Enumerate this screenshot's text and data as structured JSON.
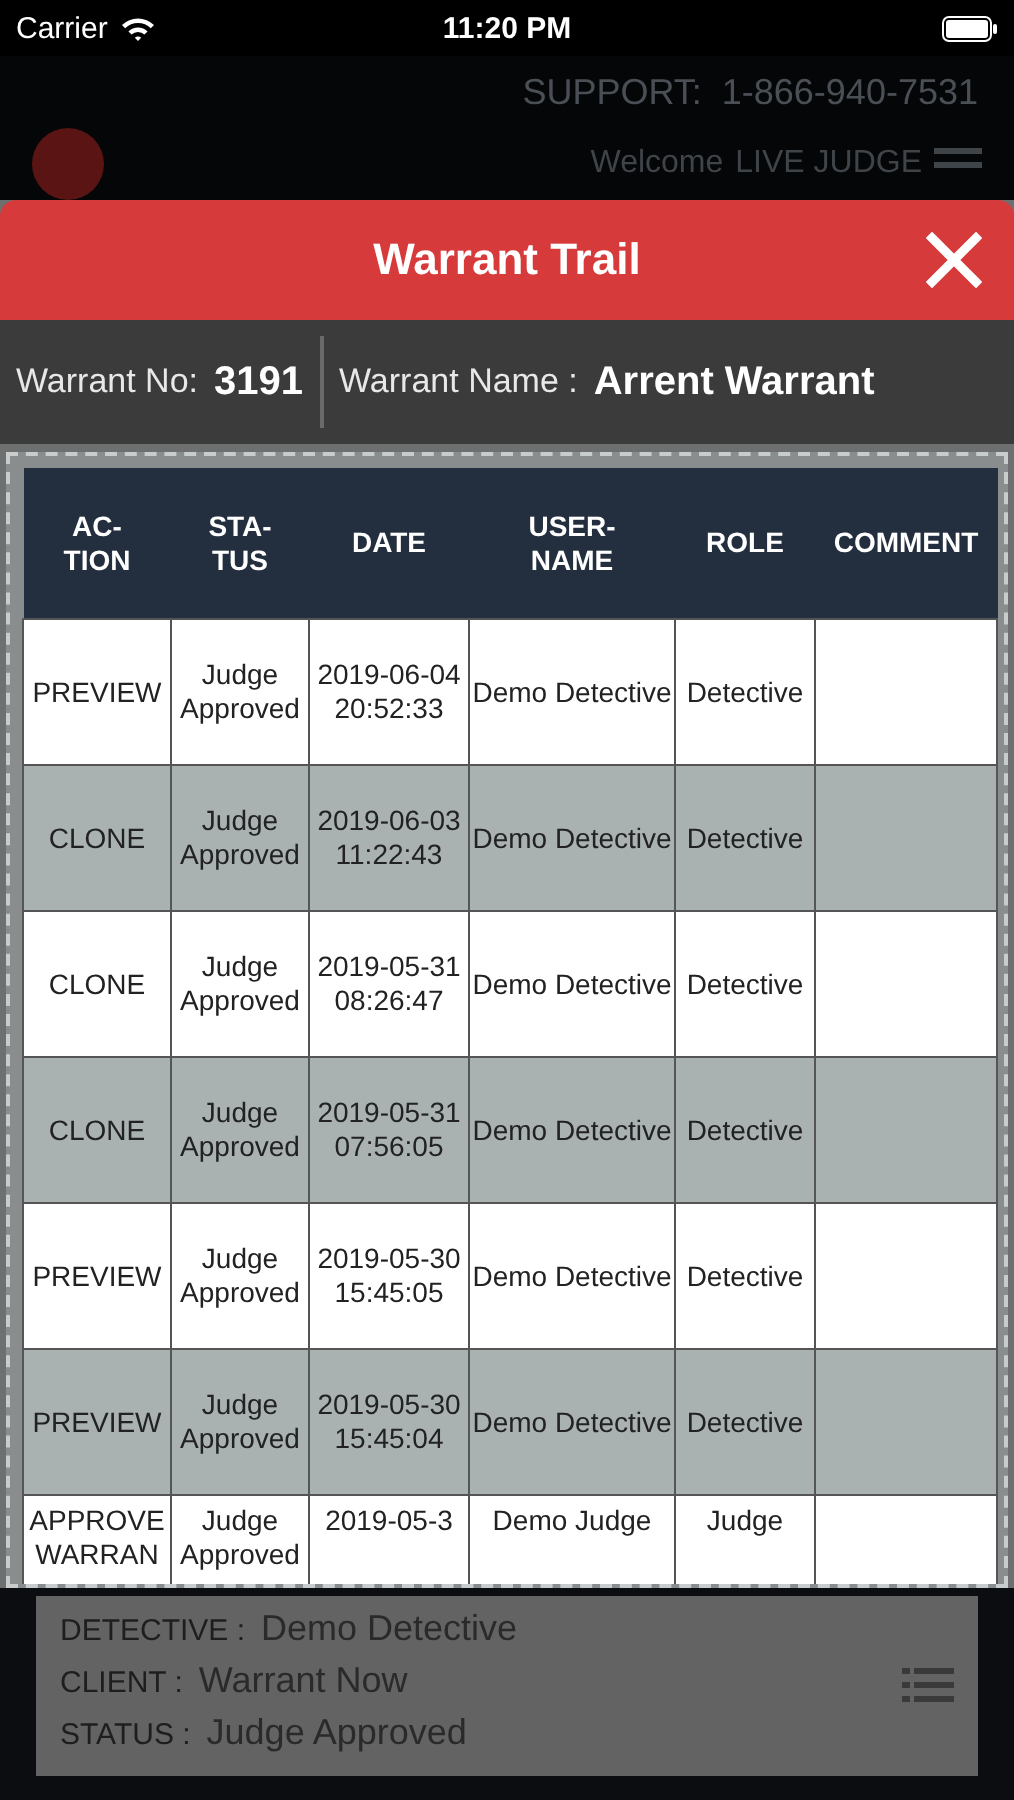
{
  "status_bar": {
    "carrier": "Carrier",
    "time": "11:20 PM"
  },
  "header": {
    "support_label": "SUPPORT:",
    "support_phone": "1-866-940-7531",
    "welcome": "Welcome",
    "user": "LIVE JUDGE"
  },
  "modal": {
    "title": "Warrant Trail",
    "warrant_no_label": "Warrant No:",
    "warrant_no": "3191",
    "warrant_name_label": "Warrant Name :",
    "warrant_name": "Arrent Warrant"
  },
  "table": {
    "columns": [
      "AC-\nTION",
      "STA-\nTUS",
      "DATE",
      "USER-\nNAME",
      "ROLE",
      "COMMENT"
    ],
    "rows": [
      [
        "PREVIEW",
        "Judge Approved",
        "2019-06-04 20:52:33",
        "Demo Detective",
        "Detective",
        ""
      ],
      [
        "CLONE",
        "Judge Approved",
        "2019-06-03 11:22:43",
        "Demo Detective",
        "Detective",
        ""
      ],
      [
        "CLONE",
        "Judge Approved",
        "2019-05-31 08:26:47",
        "Demo Detective",
        "Detective",
        ""
      ],
      [
        "CLONE",
        "Judge Approved",
        "2019-05-31 07:56:05",
        "Demo Detective",
        "Detective",
        ""
      ],
      [
        "PREVIEW",
        "Judge Approved",
        "2019-05-30 15:45:05",
        "Demo Detective",
        "Detective",
        ""
      ],
      [
        "PREVIEW",
        "Judge Approved",
        "2019-05-30 15:45:04",
        "Demo Detective",
        "Detective",
        ""
      ],
      [
        "APPROVE WARRAN",
        "Judge Approved",
        "2019-05-3",
        "Demo Judge",
        "Judge",
        ""
      ]
    ]
  },
  "details": [
    {
      "label": "DETECTIVE :",
      "value": "Demo Detective"
    },
    {
      "label": "CLIENT :",
      "value": "Warrant Now"
    },
    {
      "label": "STATUS :",
      "value": "Judge Approved"
    }
  ]
}
